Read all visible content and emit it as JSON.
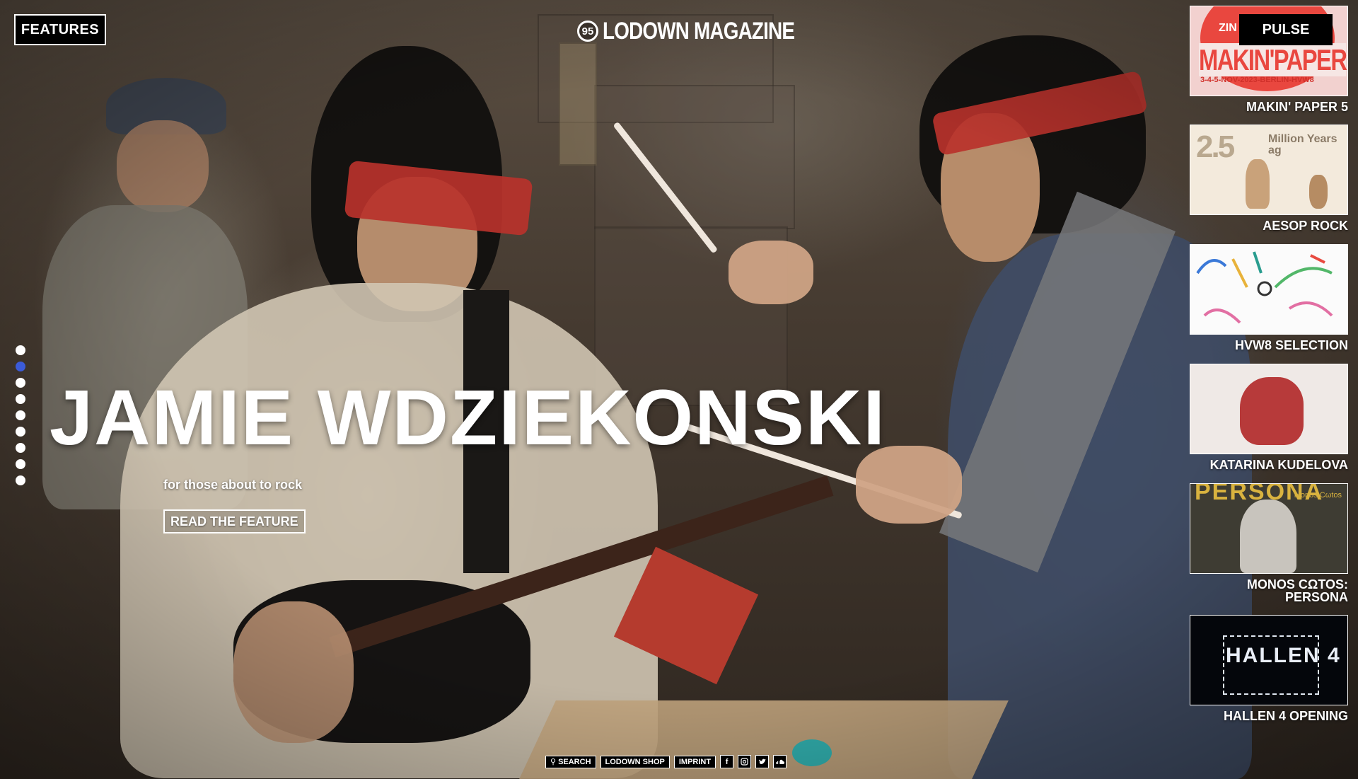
{
  "nav": {
    "features_label": "FEATURES",
    "pulse_label": "PULSE"
  },
  "logo": {
    "badge": "95",
    "text": "LODOWN MAGAZINE"
  },
  "hero": {
    "title": "JAMIE WDZIEKONSKI",
    "subtitle": "for those about to rock",
    "cta_label": "READ THE FEATURE"
  },
  "slider": {
    "total": 9,
    "active_index": 2
  },
  "pulse": {
    "items": [
      {
        "label": "MAKIN' PAPER 5",
        "thumb_text_top": "ZIN",
        "thumb_text_main": "MAKIN'PAPER",
        "thumb_text_dates": "3-4-5-NOV-2023-BERLIN-HVW8"
      },
      {
        "label": "AESOP ROCK",
        "thumb_text_top": "2.5",
        "thumb_text_main": "Million Years ag"
      },
      {
        "label": "HVW8 SELECTION"
      },
      {
        "label": "KATARINA KUDELOVA"
      },
      {
        "label": "MONOS CΩTOS: PERSONA",
        "thumb_text_top": "PERSONA",
        "thumb_text_main": "Monos Cωtos"
      },
      {
        "label": "HALLEN 4 OPENING",
        "thumb_text_main": "HALLEN 4"
      }
    ]
  },
  "footer": {
    "search_label": "SEARCH",
    "shop_label": "LODOWN SHOP",
    "imprint_label": "IMPRINT",
    "icons": [
      "facebook-icon",
      "instagram-icon",
      "twitter-icon",
      "soundcloud-icon"
    ]
  }
}
